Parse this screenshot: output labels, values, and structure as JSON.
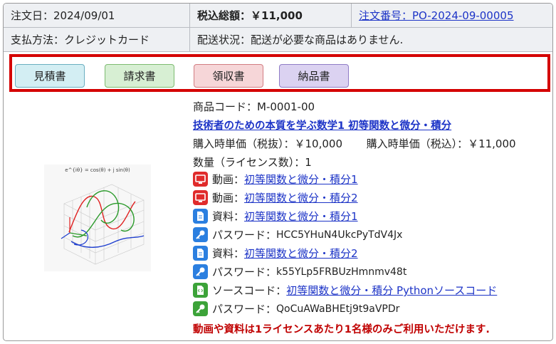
{
  "order": {
    "date_label": "注文日：2024/09/01",
    "total_label": "税込総額：￥11,000",
    "number_label": "注文番号：PO-2024-09-00005",
    "payment_label": "支払方法：クレジットカード",
    "shipping_label": "配送状況：配送が必要な商品はありません."
  },
  "buttons": {
    "estimate": "見積書",
    "invoice": "請求書",
    "receipt": "領収書",
    "delivery": "納品書"
  },
  "product": {
    "thumbnail_title": "e^{iθ} = cos(θ) + j sin(θ)",
    "code": "商品コード：M-0001-00",
    "title": "技術者のための本質を学ぶ数学1 初等関数と微分・積分",
    "price_ex": "購入時単価（税抜）：￥10,000",
    "price_in": "購入時単価（税込）：￥11,000",
    "quantity": "数量（ライセンス数）：1"
  },
  "resources": [
    {
      "icon": "video-icon",
      "label": "動画：",
      "link": "初等関数と微分・積分1"
    },
    {
      "icon": "video-icon",
      "label": "動画：",
      "link": "初等関数と微分・積分2"
    },
    {
      "icon": "document-icon",
      "label": "資料：",
      "link": "初等関数と微分・積分1"
    },
    {
      "icon": "key-icon",
      "label": "パスワード：",
      "value": "HCC5YHuN4UkcPyTdV4Jx"
    },
    {
      "icon": "document-icon",
      "label": "資料：",
      "link": "初等関数と微分・積分2"
    },
    {
      "icon": "key-icon",
      "label": "パスワード：",
      "value": "k55YLp5FRBUzHmnmv48t"
    },
    {
      "icon": "source-code-icon",
      "label": "ソースコード：",
      "link": "初等関数と微分・積分 Pythonソースコード"
    },
    {
      "icon": "key-icon",
      "label": "パスワード：",
      "value": "QoCuAWaBHEtj9t9aVPDr"
    }
  ],
  "notice": "動画や資料は1ライセンスあたり1名様のみご利用いただけます."
}
